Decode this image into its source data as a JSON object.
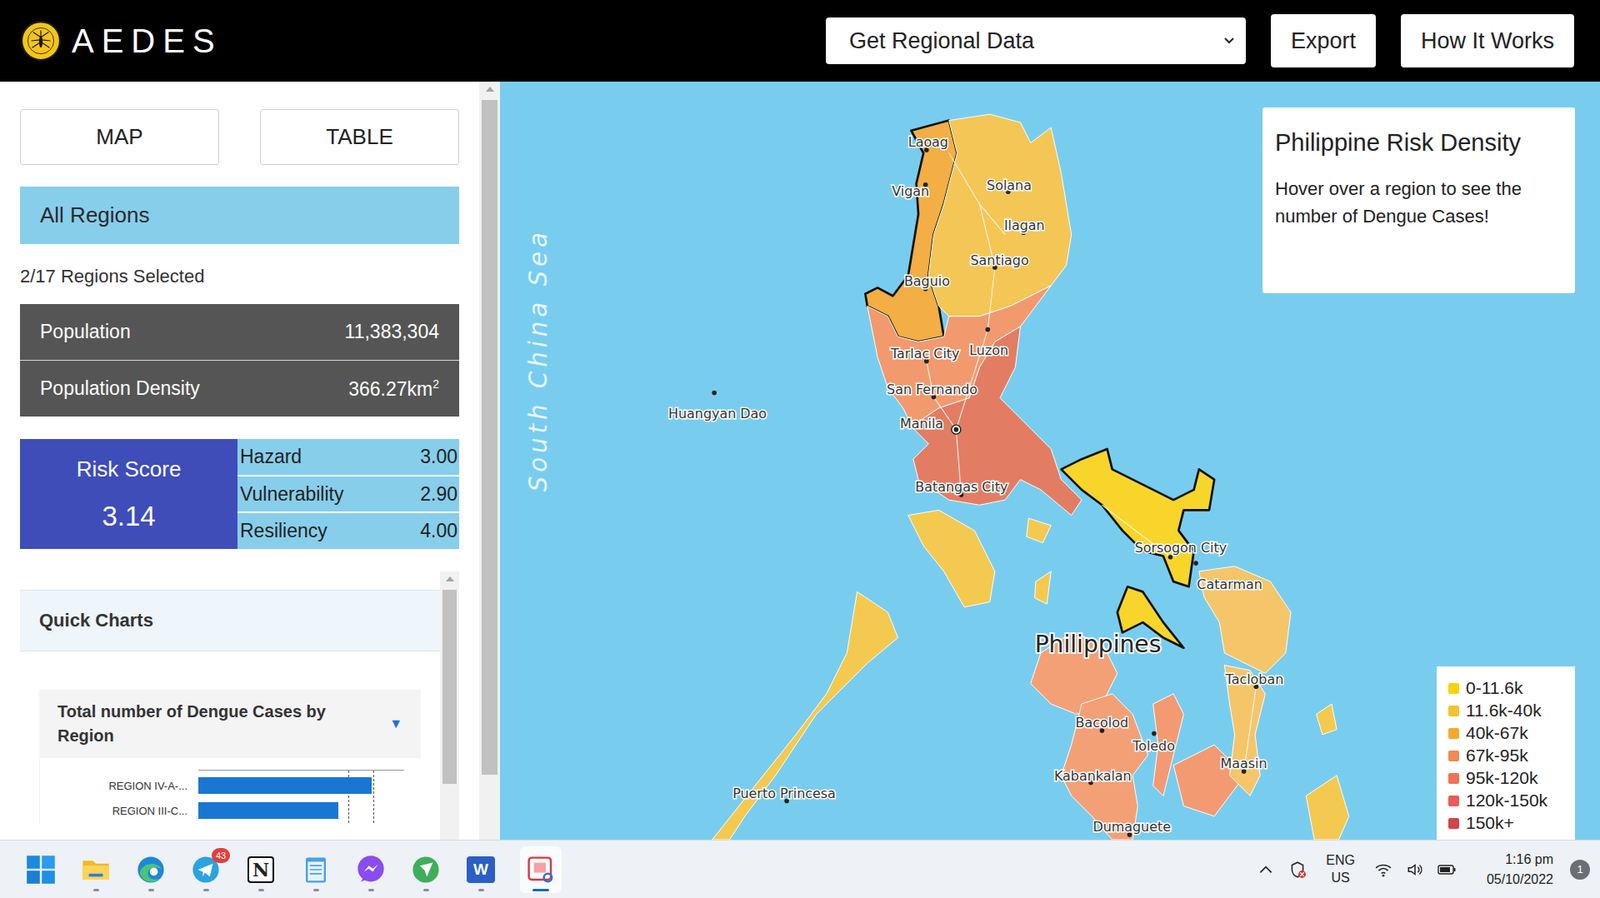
{
  "header": {
    "logo": "AEDES",
    "dropdown": {
      "label": "Get Regional Data"
    },
    "buttons": [
      "Export",
      "How It Works"
    ]
  },
  "view_buttons": [
    "MAP",
    "TABLE"
  ],
  "region_filter": "All Regions",
  "selection_count": "2/17 Regions Selected",
  "stats": [
    {
      "label": "Population",
      "value": "11,383,304",
      "unit_exponent": ""
    },
    {
      "label": "Population Density",
      "value": "366.27km",
      "unit_exponent": "2"
    }
  ],
  "risk": {
    "label": "Risk Score",
    "score": "3.14",
    "components": [
      {
        "label": "Hazard",
        "value": "3.00"
      },
      {
        "label": "Vulnerability",
        "value": "2.90"
      },
      {
        "label": "Resiliency",
        "value": "4.00"
      }
    ]
  },
  "quick_charts": {
    "title": "Quick Charts",
    "chart": {
      "title": "Total number of Dengue Cases by Region",
      "toggle": "▼",
      "bars": [
        {
          "label": "REGION IV-A-...",
          "value": 170
        },
        {
          "label": "REGION III-C...",
          "value": 137
        }
      ]
    }
  },
  "map": {
    "sea_label": "South China Sea",
    "country_label": "Philippines",
    "places": [
      {
        "name": "Laoag",
        "capital": false
      },
      {
        "name": "Vigan",
        "capital": false
      },
      {
        "name": "Solana",
        "capital": false
      },
      {
        "name": "Ilagan",
        "capital": false
      },
      {
        "name": "Santiago",
        "capital": false
      },
      {
        "name": "Baguio",
        "capital": false
      },
      {
        "name": "Luzon",
        "capital": false
      },
      {
        "name": "Tarlac City",
        "capital": false
      },
      {
        "name": "San Fernando",
        "capital": false
      },
      {
        "name": "Manila",
        "capital": true
      },
      {
        "name": "Batangas City",
        "capital": false
      },
      {
        "name": "Sorsogon City",
        "capital": false
      },
      {
        "name": "Catarman",
        "capital": false
      },
      {
        "name": "Huangyan Dao",
        "capital": false
      },
      {
        "name": "Puerto Princesa",
        "capital": false
      },
      {
        "name": "Tacloban",
        "capital": false
      },
      {
        "name": "Bacolod",
        "capital": false
      },
      {
        "name": "Toledo",
        "capital": false
      },
      {
        "name": "Kabankalan",
        "capital": false
      },
      {
        "name": "Maasin",
        "capital": false
      },
      {
        "name": "Dumaguete",
        "capital": false
      }
    ],
    "regions": [
      {
        "color": "#f3ae45",
        "selected": true
      },
      {
        "color": "#f4c655",
        "selected": false
      },
      {
        "color": "#f29a6e",
        "selected": false
      },
      {
        "color": "#e27d63",
        "selected": false
      },
      {
        "color": "#f8d52a",
        "selected": true
      },
      {
        "color": "#f4c94f",
        "selected": false
      },
      {
        "color": "#f4a077",
        "selected": false
      },
      {
        "color": "#f39a72",
        "selected": false
      },
      {
        "color": "#f5c56a",
        "selected": false
      },
      {
        "color": "#f4c94f",
        "selected": false
      }
    ],
    "info": {
      "title": "Philippine Risk Density",
      "text": "Hover over a region to see the number of Dengue Cases!"
    },
    "legend": [
      {
        "label": "0-11.6k",
        "color": "#f8d20a"
      },
      {
        "label": "11.6k-40k",
        "color": "#f5c230"
      },
      {
        "label": "40k-67k",
        "color": "#f5a92c"
      },
      {
        "label": "67k-95k",
        "color": "#f08a50"
      },
      {
        "label": "95k-120k",
        "color": "#ee7359"
      },
      {
        "label": "120k-150k",
        "color": "#e95b58"
      },
      {
        "label": "150k+",
        "color": "#d04545"
      }
    ]
  },
  "taskbar": {
    "apps": [
      {
        "kind": "start",
        "running": false,
        "active": false
      },
      {
        "kind": "explorer",
        "running": true,
        "active": false
      },
      {
        "kind": "edge",
        "running": true,
        "active": false
      },
      {
        "kind": "telegram",
        "running": true,
        "active": false,
        "badge": "43"
      },
      {
        "kind": "notion",
        "running": true,
        "active": false,
        "glyph": "N"
      },
      {
        "kind": "notepad",
        "running": true,
        "active": false
      },
      {
        "kind": "messenger",
        "running": true,
        "active": false
      },
      {
        "kind": "vpn",
        "running": true,
        "active": false
      },
      {
        "kind": "word",
        "running": true,
        "active": false,
        "glyph": "W"
      },
      {
        "kind": "snip",
        "running": true,
        "active": true
      }
    ],
    "tray": {
      "language": "ENG",
      "region": "US",
      "time": "1:16 pm",
      "date": "05/10/2022",
      "notifications": "1"
    }
  }
}
